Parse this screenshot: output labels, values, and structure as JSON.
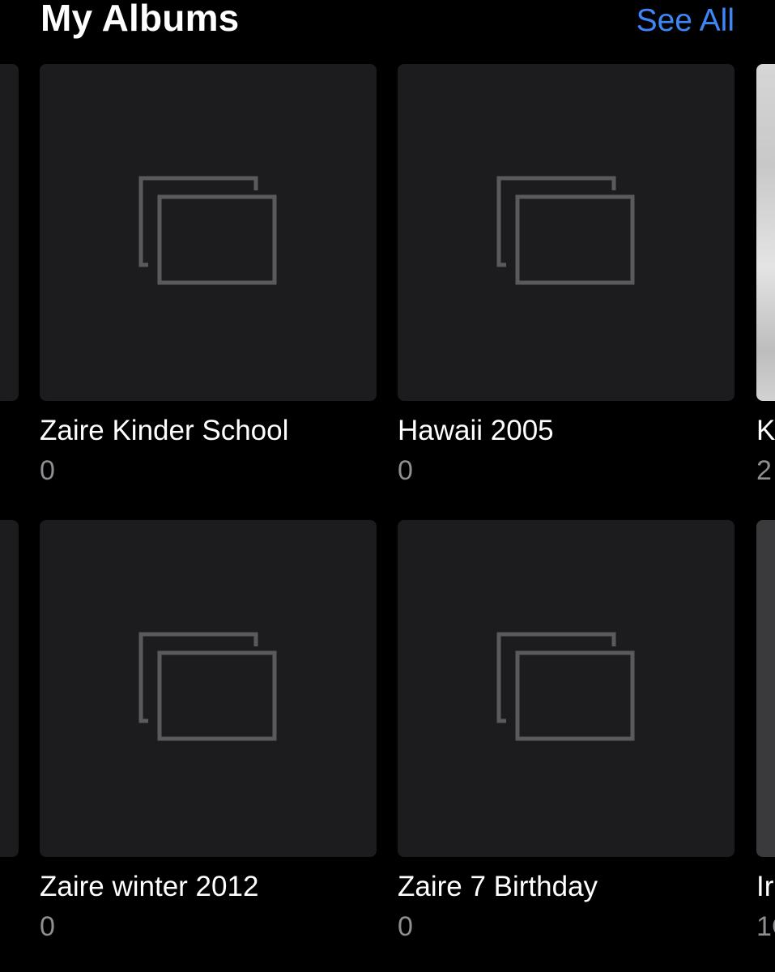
{
  "header": {
    "title": "My Albums",
    "see_all_label": "See All"
  },
  "albums": [
    {
      "name": "Zaire Kinder School",
      "count": "0",
      "icon": "album-placeholder-icon"
    },
    {
      "name": "Hawaii 2005",
      "count": "0",
      "icon": "album-placeholder-icon"
    },
    {
      "name": "Zaire winter 2012",
      "count": "0",
      "icon": "album-placeholder-icon"
    },
    {
      "name": "Zaire 7 Birthday",
      "count": "0",
      "icon": "album-placeholder-icon"
    }
  ],
  "partial_albums": [
    {
      "name_fragment": "K",
      "count_fragment": "2"
    },
    {
      "name_fragment": "Ir",
      "count_fragment": "1C"
    }
  ],
  "colors": {
    "background": "#000000",
    "tile": "#1c1c1e",
    "accent": "#3d86f6",
    "secondary_text": "#8e8e93",
    "icon_stroke": "#5a5a5e"
  }
}
